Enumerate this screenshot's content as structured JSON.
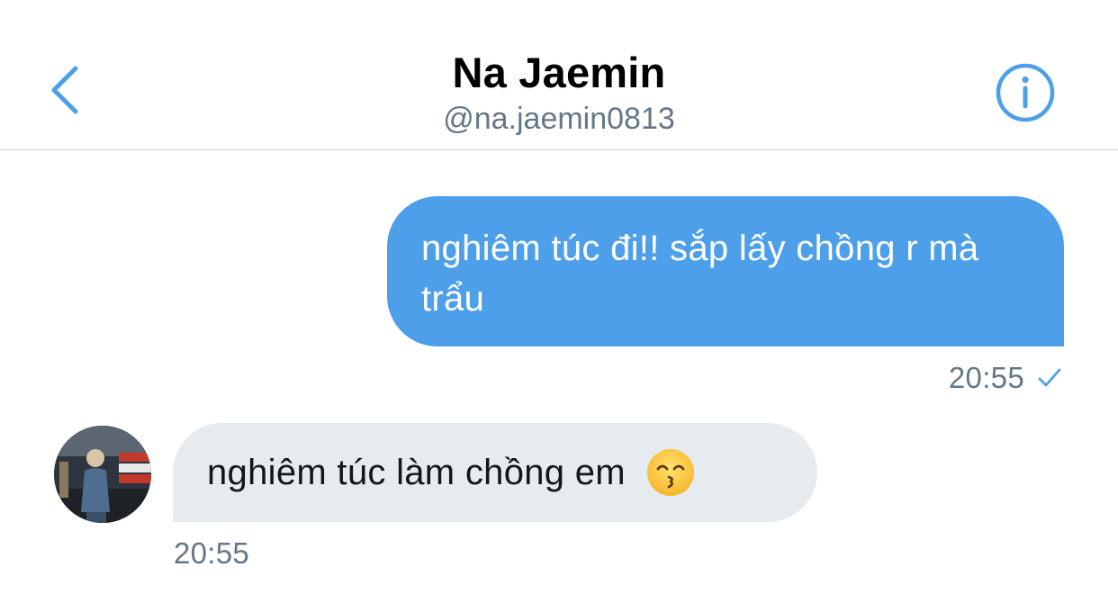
{
  "header": {
    "title": "Na Jaemin",
    "handle": "@na.jaemin0813",
    "back_icon": "chevron-left-icon",
    "info_icon": "info-circle-icon",
    "accent_color": "#4d9fe9"
  },
  "messages": [
    {
      "direction": "outgoing",
      "text": "nghiêm túc đi!! sắp lấy chồng r mà trẩu",
      "time": "20:55",
      "status_icon": "check-icon",
      "bubble_color": "#4d9fe9"
    },
    {
      "direction": "incoming",
      "text": "nghiêm túc làm chồng em",
      "emoji": "kissing-face-smiling-eyes-icon",
      "time": "20:55",
      "avatar": "avatar",
      "bubble_color": "#e6ebf0"
    }
  ]
}
